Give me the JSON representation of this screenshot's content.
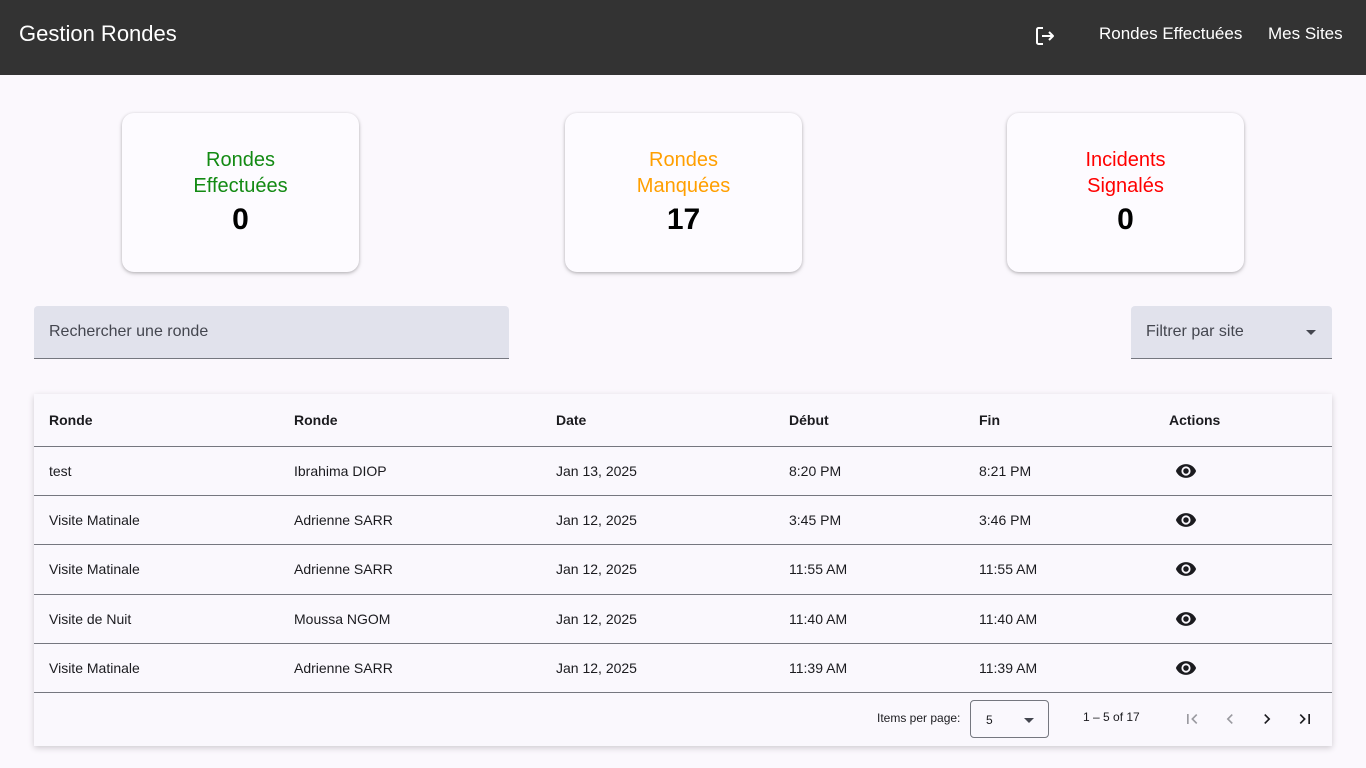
{
  "toolbar": {
    "title": "Gestion Rondes",
    "logout_icon": "logout-icon",
    "nav": [
      "Rondes Effectuées",
      "Mes Sites"
    ]
  },
  "stats": [
    {
      "label": "Rondes Effectuées",
      "value": "0",
      "color": "#138a13"
    },
    {
      "label": "Rondes Manquées",
      "value": "17",
      "color": "#ff9f00"
    },
    {
      "label": "Incidents Signalés",
      "value": "0",
      "color": "#ff0000"
    }
  ],
  "search": {
    "placeholder": "Rechercher une ronde"
  },
  "filter": {
    "label": "Filtrer par site"
  },
  "table": {
    "headers": [
      "Ronde",
      "Ronde",
      "Date",
      "Début",
      "Fin",
      "Actions"
    ],
    "rows": [
      [
        "test",
        "Ibrahima DIOP",
        "Jan 13, 2025",
        "8:20 PM",
        "8:21 PM"
      ],
      [
        "Visite Matinale",
        "Adrienne SARR",
        "Jan 12, 2025",
        "3:45 PM",
        "3:46 PM"
      ],
      [
        "Visite Matinale",
        "Adrienne SARR",
        "Jan 12, 2025",
        "11:55 AM",
        "11:55 AM"
      ],
      [
        "Visite de Nuit",
        "Moussa NGOM",
        "Jan 12, 2025",
        "11:40 AM",
        "11:40 AM"
      ],
      [
        "Visite Matinale",
        "Adrienne SARR",
        "Jan 12, 2025",
        "11:39 AM",
        "11:39 AM"
      ]
    ],
    "action_icon": "eye-icon"
  },
  "paginator": {
    "items_per_page_label": "Items per page:",
    "page_size": "5",
    "range_label": "1 – 5 of 17"
  }
}
